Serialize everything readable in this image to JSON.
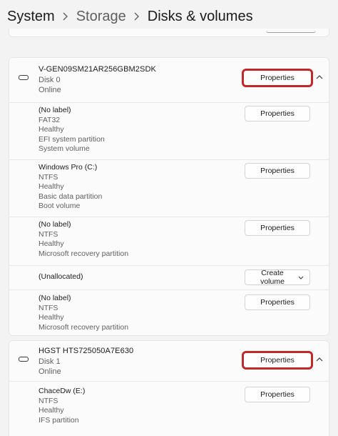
{
  "breadcrumb": {
    "system": "System",
    "storage": "Storage",
    "current": "Disks & volumes"
  },
  "disks": [
    {
      "name": "V-GEN09SM21AR256GBM2SDK",
      "number": "Disk 0",
      "status": "Online",
      "properties_label": "Properties",
      "volumes": [
        {
          "name": "(No label)",
          "lines": [
            "FAT32",
            "Healthy",
            "EFI system partition",
            "System volume"
          ],
          "button_label": "Properties"
        },
        {
          "name": "Windows Pro  (C:)",
          "lines": [
            "NTFS",
            "Healthy",
            "Basic data partition",
            "Boot volume"
          ],
          "button_label": "Properties"
        },
        {
          "name": "(No label)",
          "lines": [
            "NTFS",
            "Healthy",
            "Microsoft recovery partition"
          ],
          "button_label": "Properties"
        },
        {
          "name": "(Unallocated)",
          "lines": [],
          "button_label": "Create volume"
        },
        {
          "name": "(No label)",
          "lines": [
            "NTFS",
            "Healthy",
            "Microsoft recovery partition"
          ],
          "button_label": "Properties"
        }
      ]
    },
    {
      "name": "HGST HTS725050A7E630",
      "number": "Disk 1",
      "status": "Online",
      "properties_label": "Properties",
      "volumes": [
        {
          "name": "ChaceDw (E:)",
          "lines": [
            "NTFS",
            "Healthy",
            "IFS partition"
          ],
          "button_label": "Properties"
        }
      ]
    }
  ],
  "colors": {
    "highlight": "#c0292b",
    "background": "#f3f3f3",
    "card": "#fbfbfb"
  }
}
